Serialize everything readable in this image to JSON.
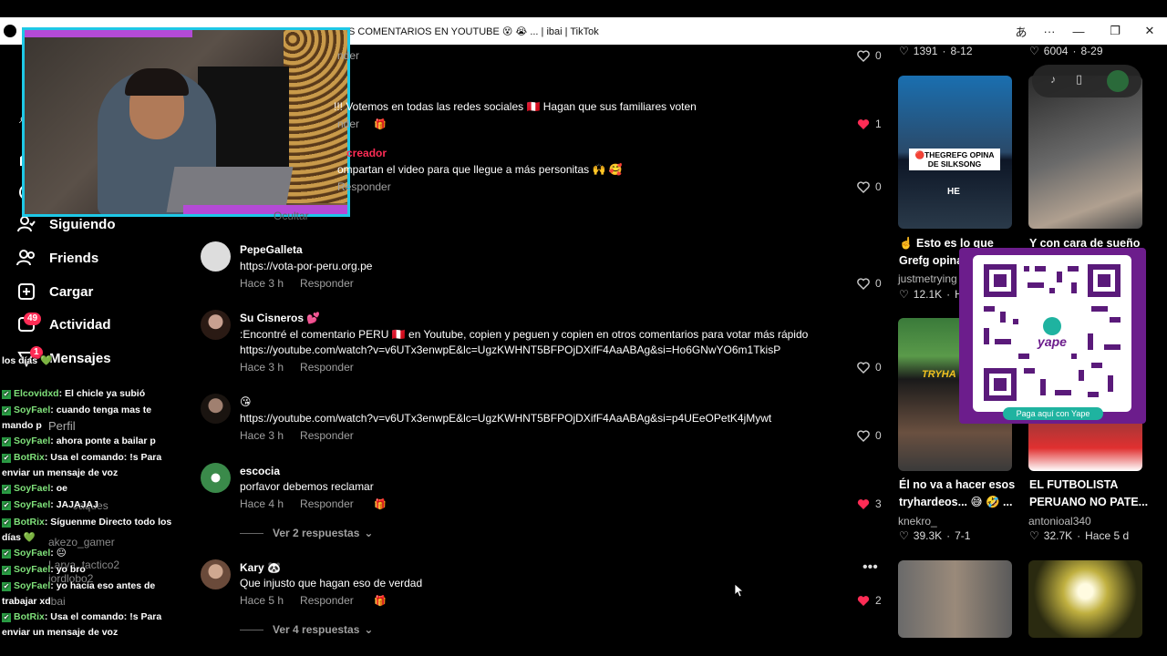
{
  "window": {
    "title": "TikTok - (5U)Respuesta a @ibaillanosDESAPARECIERON LOS COMENTARIOS EN YOUTUBE 😵 😭 ... | ibai | TikTok",
    "translate_icon": "translate-icon"
  },
  "sidebar": {
    "items": [
      {
        "label": "Siguiendo"
      },
      {
        "label": "Friends"
      },
      {
        "label": "Cargar"
      },
      {
        "label": "Actividad",
        "badge": "49"
      },
      {
        "label": "Mensajes",
        "badge": "1"
      }
    ],
    "profile_label": "Perfil",
    "following_faded": [
      "akezo_gamer",
      "Larva_tactico2",
      "jordlobo2",
      "ibai",
      "Jaques"
    ]
  },
  "chat": [
    {
      "user": "",
      "text": "los días 💚"
    },
    {
      "user": "Elcovidxd",
      "text": ": El chicle ya subió"
    },
    {
      "user": "SoyFael",
      "text": ": cuando tenga mas te mando p"
    },
    {
      "user": "SoyFael",
      "text": ": ahora ponte a bailar p"
    },
    {
      "user": "BotRix",
      "text": ": Usa el comando: !s Para enviar un mensaje de voz"
    },
    {
      "user": "SoyFael",
      "text": ": oe"
    },
    {
      "user": "SoyFael",
      "text": ": JAJAJAJ"
    },
    {
      "user": "BotRix",
      "text": ": Síguenme Directo todo los días 💚"
    },
    {
      "user": "SoyFael",
      "text": ": 😐"
    },
    {
      "user": "SoyFael",
      "text": ": yo bro"
    },
    {
      "user": "SoyFael",
      "text": ": yo hacia eso antes de trabajar xd"
    },
    {
      "user": "BotRix",
      "text": ": Usa el comando: !s Para enviar un mensaje de voz"
    }
  ],
  "comments": {
    "top_partial": [
      {
        "text_reply": "nder",
        "likes": "0"
      },
      {
        "text": "!!! Votemos en todas las redes sociales 🇵🇪 Hagan que sus familiares voten",
        "reply": "nder",
        "likes": "1"
      },
      {
        "creator_tag": "creador",
        "text": "ompartan el video para que llegue a más personitas 🙌 🥰",
        "reply": "Responder",
        "likes": "0"
      }
    ],
    "hide_label": "Ocultar",
    "list": [
      {
        "name": "PepeGalleta",
        "text": "https://vota-por-peru.org.pe",
        "time": "Hace 3 h",
        "reply": "Responder",
        "likes": "0"
      },
      {
        "name": "Su Cisneros 💕",
        "text": ":Encontré el comentario PERU 🇵🇪 en Youtube, copien y peguen y copien en otros comentarios para votar más rápido",
        "text2": "https://youtube.com/watch?v=v6UTx3enwpE&lc=UgzKWHNT5BFPOjDXifF4AaABAg&si=Ho6GNwYO6m1TkisP",
        "time": "Hace 3 h",
        "reply": "Responder",
        "likes": "0"
      },
      {
        "name": "😘",
        "text": "https://youtube.com/watch?v=v6UTx3enwpE&lc=UgzKWHNT5BFPOjDXifF4AaABAg&si=p4UEeOPetK4jMywt",
        "time": "Hace 3 h",
        "reply": "Responder",
        "likes": "0"
      },
      {
        "name": "escocia",
        "text": "porfavor debemos reclamar",
        "time": "Hace 4 h",
        "reply": "Responder",
        "likes": "3",
        "replies": "Ver 2 respuestas"
      },
      {
        "name": "Kary 🐼",
        "text": "Que injusto que hagan eso de verdad",
        "time": "Hace 5 h",
        "reply": "Responder",
        "likes": "2",
        "replies": "Ver 4 respuestas"
      }
    ]
  },
  "videos": {
    "top_stats": [
      {
        "likes": "1391",
        "date": "8-12"
      },
      {
        "likes": "6004",
        "date": "8-29"
      }
    ],
    "grid": [
      {
        "title": "☝️ Esto es lo que Grefg opina",
        "author": "justmetrying",
        "likes": "12.1K",
        "date": "H",
        "overlay": "🔴THEGREFG OPINA DE SILKSONG",
        "overlay2": "HE"
      },
      {
        "title": "Y con cara de sueño",
        "author": "",
        "likes": "",
        "date": ""
      },
      {
        "title": "Él no va a hacer esos tryhardeos... 😅 🤣 ...",
        "author": "knekro_",
        "likes": "39.3K",
        "date": "7-1",
        "overlay": "TRYHA"
      },
      {
        "title": "EL FUTBOLISTA PERUANO NO PATE...",
        "author": "antonioal340",
        "likes": "32.7K",
        "date": "Hace 5 d"
      }
    ]
  },
  "qr": {
    "label": "Paga aquí con Yape",
    "brand": "yape"
  },
  "colors": {
    "accent": "#fe2c55",
    "chat_user": "#7fe07a",
    "webcam_border": "#1ec8e6",
    "yape_purple": "#6c1d8c"
  }
}
